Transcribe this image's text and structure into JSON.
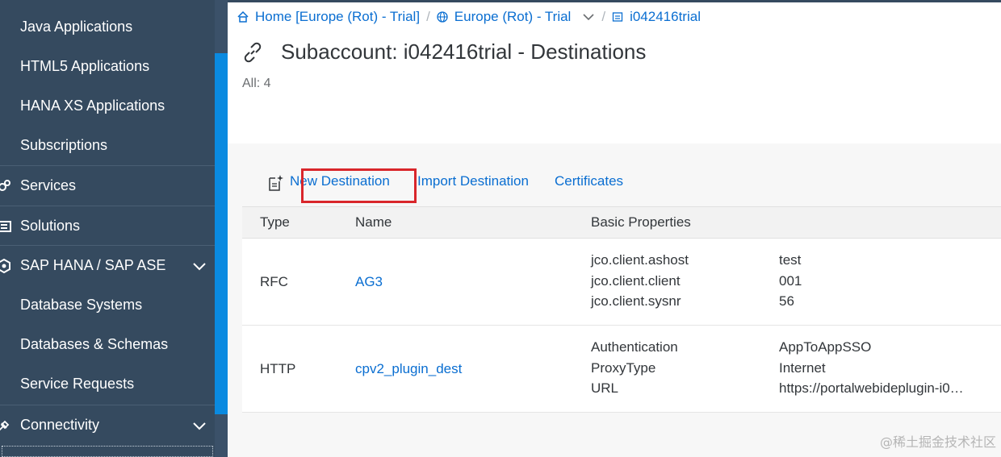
{
  "sidebar": {
    "items": [
      {
        "label": "Java Applications",
        "kind": "sub"
      },
      {
        "label": "HTML5 Applications",
        "kind": "sub"
      },
      {
        "label": "HANA XS Applications",
        "kind": "sub"
      },
      {
        "label": "Subscriptions",
        "kind": "sub"
      },
      {
        "label": "Services",
        "kind": "parent",
        "icon": "services-icon"
      },
      {
        "label": "Solutions",
        "kind": "parent",
        "icon": "solutions-icon"
      },
      {
        "label": "SAP HANA / SAP ASE",
        "kind": "parent",
        "icon": "hana-icon",
        "expandable": true
      },
      {
        "label": "Database Systems",
        "kind": "sub"
      },
      {
        "label": "Databases & Schemas",
        "kind": "sub"
      },
      {
        "label": "Service Requests",
        "kind": "sub"
      },
      {
        "label": "Connectivity",
        "kind": "parent",
        "icon": "connectivity-icon",
        "expandable": true
      }
    ]
  },
  "breadcrumb": {
    "home": "Home [Europe (Rot) - Trial]",
    "region": "Europe (Rot) - Trial",
    "subaccount": "i042416trial",
    "separator": "/"
  },
  "header": {
    "title": "Subaccount: i042416trial - Destinations",
    "count": "All: 4"
  },
  "toolbar": {
    "new_destination": "New Destination",
    "import_destination": "Import Destination",
    "certificates": "Certificates"
  },
  "table": {
    "columns": {
      "type": "Type",
      "name": "Name",
      "properties": "Basic Properties"
    },
    "rows": [
      {
        "type": "RFC",
        "name": "AG3",
        "props": [
          {
            "key": "jco.client.ashost",
            "value": "test"
          },
          {
            "key": "jco.client.client",
            "value": "001"
          },
          {
            "key": "jco.client.sysnr",
            "value": "56"
          }
        ]
      },
      {
        "type": "HTTP",
        "name": "cpv2_plugin_dest",
        "props": [
          {
            "key": "Authentication",
            "value": "AppToAppSSO"
          },
          {
            "key": "ProxyType",
            "value": "Internet"
          },
          {
            "key": "URL",
            "value": "https://portalwebideplugin-i0…"
          }
        ]
      }
    ]
  },
  "watermark": "@稀土掘金技术社区",
  "colors": {
    "sidebar": "#354a5f",
    "accent": "#0a6ed1",
    "scroll": "#0a8ae0",
    "highlight": "#d9262b"
  }
}
